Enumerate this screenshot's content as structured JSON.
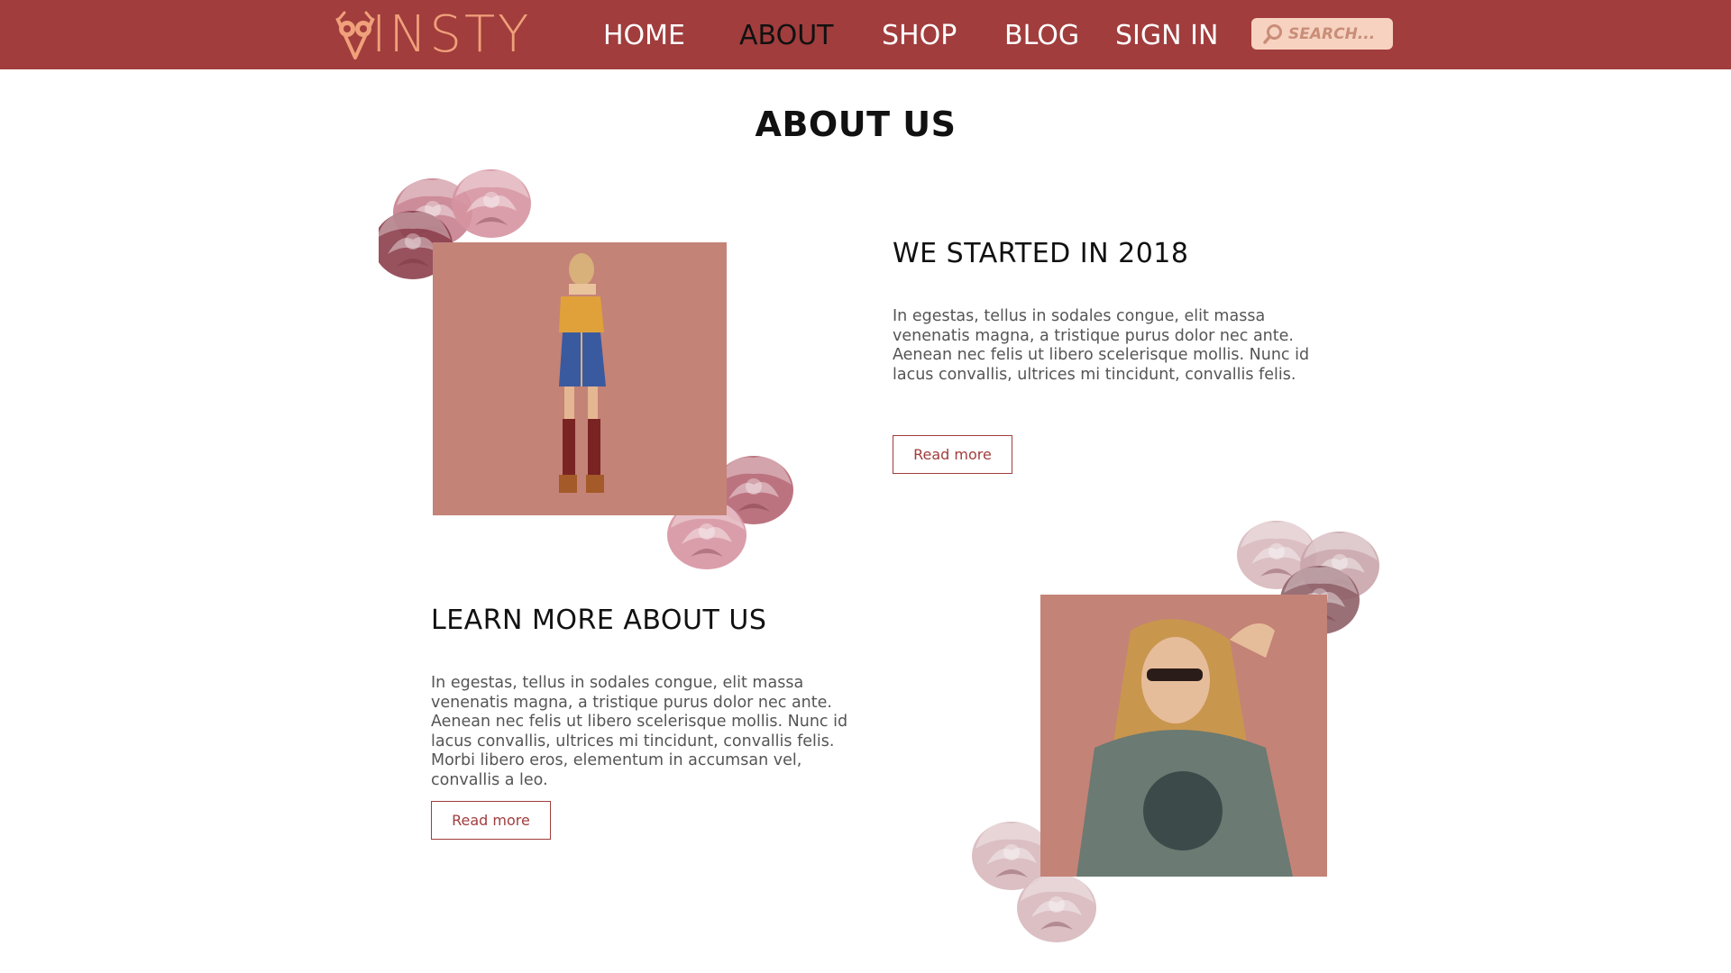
{
  "brand": {
    "logo_text": "INSTY",
    "logo_name": "vinsty-logo"
  },
  "nav": {
    "items": [
      {
        "label": "HOME",
        "active": false
      },
      {
        "label": "ABOUT",
        "active": true
      },
      {
        "label": "SHOP",
        "active": false
      },
      {
        "label": "BLOG",
        "active": false
      },
      {
        "label": "SIGN IN",
        "active": false
      }
    ]
  },
  "search": {
    "placeholder": "SEARCH...",
    "value": "",
    "icon": "search-icon"
  },
  "page": {
    "title": "ABOUT US"
  },
  "sections": [
    {
      "heading": "WE STARTED IN 2018",
      "body": "In egestas, tellus in sodales congue, elit massa venenatis magna, a tristique purus dolor nec ante. Aenean nec felis ut libero scelerisque mollis. Nunc id lacus convallis, ultrices mi tincidunt, convallis felis.",
      "button": "Read more"
    },
    {
      "heading": "LEARN MORE ABOUT US",
      "body": "In egestas, tellus in sodales congue, elit massa venenatis magna, a tristique purus dolor nec ante. Aenean nec felis ut libero scelerisque mollis. Nunc id lacus convallis, ultrices mi tincidunt, convallis felis. Morbi libero eros, elementum in accumsan vel, convallis a leo.",
      "button": "Read more"
    }
  ],
  "colors": {
    "nav_bg": "#a13d3d",
    "accent": "#a13d3d",
    "logo": "#f0a07a",
    "search_bg": "#f7d2c0",
    "photo_bg": "#c48377"
  }
}
